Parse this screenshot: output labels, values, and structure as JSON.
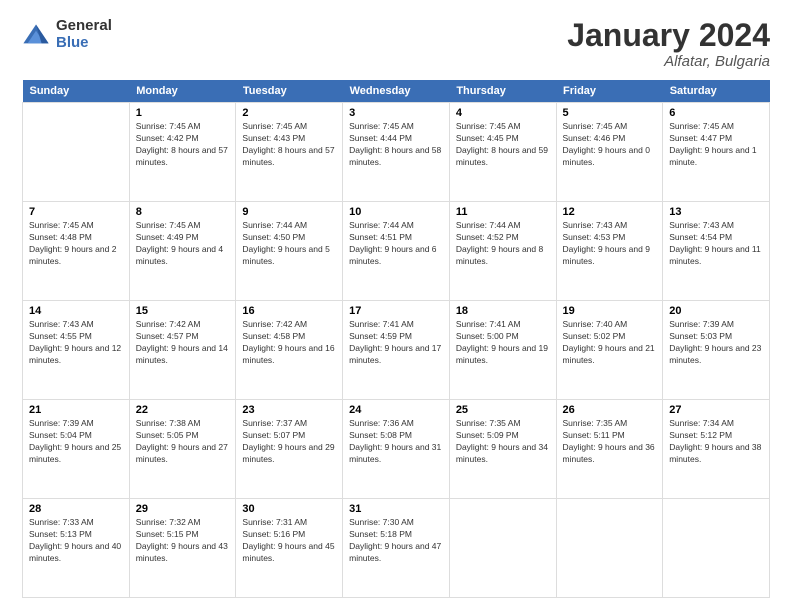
{
  "logo": {
    "general": "General",
    "blue": "Blue"
  },
  "title": {
    "month_year": "January 2024",
    "location": "Alfatar, Bulgaria"
  },
  "weekdays": [
    "Sunday",
    "Monday",
    "Tuesday",
    "Wednesday",
    "Thursday",
    "Friday",
    "Saturday"
  ],
  "weeks": [
    [
      {
        "day": "",
        "sunrise": "",
        "sunset": "",
        "daylight": ""
      },
      {
        "day": "1",
        "sunrise": "Sunrise: 7:45 AM",
        "sunset": "Sunset: 4:42 PM",
        "daylight": "Daylight: 8 hours and 57 minutes."
      },
      {
        "day": "2",
        "sunrise": "Sunrise: 7:45 AM",
        "sunset": "Sunset: 4:43 PM",
        "daylight": "Daylight: 8 hours and 57 minutes."
      },
      {
        "day": "3",
        "sunrise": "Sunrise: 7:45 AM",
        "sunset": "Sunset: 4:44 PM",
        "daylight": "Daylight: 8 hours and 58 minutes."
      },
      {
        "day": "4",
        "sunrise": "Sunrise: 7:45 AM",
        "sunset": "Sunset: 4:45 PM",
        "daylight": "Daylight: 8 hours and 59 minutes."
      },
      {
        "day": "5",
        "sunrise": "Sunrise: 7:45 AM",
        "sunset": "Sunset: 4:46 PM",
        "daylight": "Daylight: 9 hours and 0 minutes."
      },
      {
        "day": "6",
        "sunrise": "Sunrise: 7:45 AM",
        "sunset": "Sunset: 4:47 PM",
        "daylight": "Daylight: 9 hours and 1 minute."
      }
    ],
    [
      {
        "day": "7",
        "sunrise": "Sunrise: 7:45 AM",
        "sunset": "Sunset: 4:48 PM",
        "daylight": "Daylight: 9 hours and 2 minutes."
      },
      {
        "day": "8",
        "sunrise": "Sunrise: 7:45 AM",
        "sunset": "Sunset: 4:49 PM",
        "daylight": "Daylight: 9 hours and 4 minutes."
      },
      {
        "day": "9",
        "sunrise": "Sunrise: 7:44 AM",
        "sunset": "Sunset: 4:50 PM",
        "daylight": "Daylight: 9 hours and 5 minutes."
      },
      {
        "day": "10",
        "sunrise": "Sunrise: 7:44 AM",
        "sunset": "Sunset: 4:51 PM",
        "daylight": "Daylight: 9 hours and 6 minutes."
      },
      {
        "day": "11",
        "sunrise": "Sunrise: 7:44 AM",
        "sunset": "Sunset: 4:52 PM",
        "daylight": "Daylight: 9 hours and 8 minutes."
      },
      {
        "day": "12",
        "sunrise": "Sunrise: 7:43 AM",
        "sunset": "Sunset: 4:53 PM",
        "daylight": "Daylight: 9 hours and 9 minutes."
      },
      {
        "day": "13",
        "sunrise": "Sunrise: 7:43 AM",
        "sunset": "Sunset: 4:54 PM",
        "daylight": "Daylight: 9 hours and 11 minutes."
      }
    ],
    [
      {
        "day": "14",
        "sunrise": "Sunrise: 7:43 AM",
        "sunset": "Sunset: 4:55 PM",
        "daylight": "Daylight: 9 hours and 12 minutes."
      },
      {
        "day": "15",
        "sunrise": "Sunrise: 7:42 AM",
        "sunset": "Sunset: 4:57 PM",
        "daylight": "Daylight: 9 hours and 14 minutes."
      },
      {
        "day": "16",
        "sunrise": "Sunrise: 7:42 AM",
        "sunset": "Sunset: 4:58 PM",
        "daylight": "Daylight: 9 hours and 16 minutes."
      },
      {
        "day": "17",
        "sunrise": "Sunrise: 7:41 AM",
        "sunset": "Sunset: 4:59 PM",
        "daylight": "Daylight: 9 hours and 17 minutes."
      },
      {
        "day": "18",
        "sunrise": "Sunrise: 7:41 AM",
        "sunset": "Sunset: 5:00 PM",
        "daylight": "Daylight: 9 hours and 19 minutes."
      },
      {
        "day": "19",
        "sunrise": "Sunrise: 7:40 AM",
        "sunset": "Sunset: 5:02 PM",
        "daylight": "Daylight: 9 hours and 21 minutes."
      },
      {
        "day": "20",
        "sunrise": "Sunrise: 7:39 AM",
        "sunset": "Sunset: 5:03 PM",
        "daylight": "Daylight: 9 hours and 23 minutes."
      }
    ],
    [
      {
        "day": "21",
        "sunrise": "Sunrise: 7:39 AM",
        "sunset": "Sunset: 5:04 PM",
        "daylight": "Daylight: 9 hours and 25 minutes."
      },
      {
        "day": "22",
        "sunrise": "Sunrise: 7:38 AM",
        "sunset": "Sunset: 5:05 PM",
        "daylight": "Daylight: 9 hours and 27 minutes."
      },
      {
        "day": "23",
        "sunrise": "Sunrise: 7:37 AM",
        "sunset": "Sunset: 5:07 PM",
        "daylight": "Daylight: 9 hours and 29 minutes."
      },
      {
        "day": "24",
        "sunrise": "Sunrise: 7:36 AM",
        "sunset": "Sunset: 5:08 PM",
        "daylight": "Daylight: 9 hours and 31 minutes."
      },
      {
        "day": "25",
        "sunrise": "Sunrise: 7:35 AM",
        "sunset": "Sunset: 5:09 PM",
        "daylight": "Daylight: 9 hours and 34 minutes."
      },
      {
        "day": "26",
        "sunrise": "Sunrise: 7:35 AM",
        "sunset": "Sunset: 5:11 PM",
        "daylight": "Daylight: 9 hours and 36 minutes."
      },
      {
        "day": "27",
        "sunrise": "Sunrise: 7:34 AM",
        "sunset": "Sunset: 5:12 PM",
        "daylight": "Daylight: 9 hours and 38 minutes."
      }
    ],
    [
      {
        "day": "28",
        "sunrise": "Sunrise: 7:33 AM",
        "sunset": "Sunset: 5:13 PM",
        "daylight": "Daylight: 9 hours and 40 minutes."
      },
      {
        "day": "29",
        "sunrise": "Sunrise: 7:32 AM",
        "sunset": "Sunset: 5:15 PM",
        "daylight": "Daylight: 9 hours and 43 minutes."
      },
      {
        "day": "30",
        "sunrise": "Sunrise: 7:31 AM",
        "sunset": "Sunset: 5:16 PM",
        "daylight": "Daylight: 9 hours and 45 minutes."
      },
      {
        "day": "31",
        "sunrise": "Sunrise: 7:30 AM",
        "sunset": "Sunset: 5:18 PM",
        "daylight": "Daylight: 9 hours and 47 minutes."
      },
      {
        "day": "",
        "sunrise": "",
        "sunset": "",
        "daylight": ""
      },
      {
        "day": "",
        "sunrise": "",
        "sunset": "",
        "daylight": ""
      },
      {
        "day": "",
        "sunrise": "",
        "sunset": "",
        "daylight": ""
      }
    ]
  ]
}
